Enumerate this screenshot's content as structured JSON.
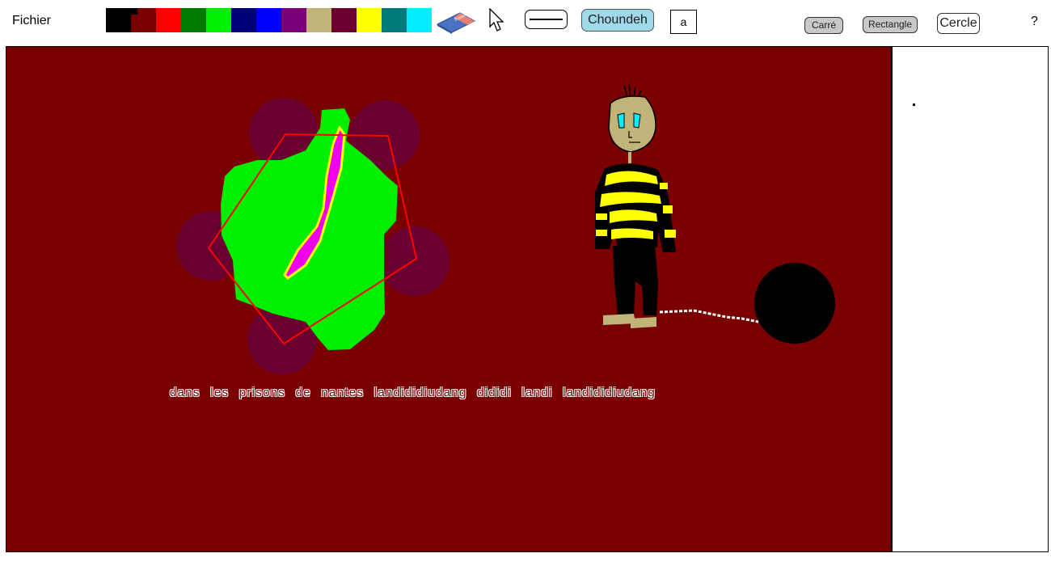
{
  "menu": {
    "file_label": "Fichier"
  },
  "palette": {
    "colors": [
      "#000000",
      "#7a0000",
      "#ff0000",
      "#007a00",
      "#00ee00",
      "#00007a",
      "#0000ff",
      "#7a007a",
      "#c0b478",
      "#6a0030",
      "#ffff00",
      "#007a7a",
      "#00eeff"
    ],
    "selected_index": 1
  },
  "toolbar": {
    "eraser_icon": "eraser-icon",
    "pointer_icon": "pointer-icon",
    "line_width_icon": "line-width-icon",
    "font_label": "Choundeh",
    "text_tool_label": "a",
    "square_label": "Carré",
    "rectangle_label": "Rectangle",
    "circle_label": "Cercle",
    "help_label": "?"
  },
  "canvas": {
    "background": "#7a0000",
    "text": "dans les prisons de nantes landididiudang dididi landi landididiudang"
  }
}
